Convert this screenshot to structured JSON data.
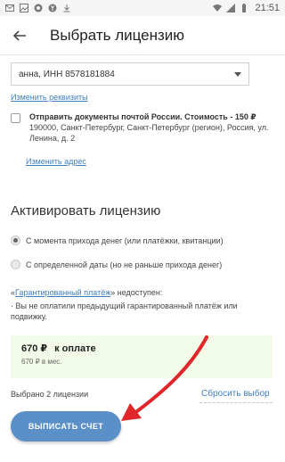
{
  "status_bar": {
    "time": "21:51"
  },
  "header": {
    "title": "Выбрать лицензию"
  },
  "requisites": {
    "selected": "анна, ИНН 8578181884",
    "edit_link": "Изменить реквизиты"
  },
  "post_delivery": {
    "label": "Отправить документы почтой России. Стоимость - 150 ₽",
    "address": "190000, Санкт-Петербург, Санкт-Петербург (регион), Россия, ул. Ленина, д. 2",
    "change_address_link": "Изменить адрес",
    "checked": false
  },
  "activation": {
    "title": "Активировать лицензию",
    "options": [
      {
        "label": "С момента прихода денег (или платёжки, квитанции)",
        "selected": true
      },
      {
        "label": "С определенной даты (но не раньше прихода денег)",
        "selected": false
      }
    ]
  },
  "guarantee": {
    "prefix": "«",
    "link": "Гарантированный платёж",
    "suffix": "» недоступен:",
    "reason": "· Вы не оплатили предыдущий гарантированный платёж или подвижку."
  },
  "payment": {
    "amount": "670 ₽",
    "label": "к оплате",
    "per_month": "670 ₽ в мес."
  },
  "selection": {
    "count_text": "Выбрано 2 лицензии",
    "reset_link": "Сбросить выбор"
  },
  "action": {
    "invoice_button": "ВЫПИСАТЬ СЧЕТ"
  },
  "colors": {
    "accent": "#5b8fc7",
    "link": "#3f7fbf",
    "pay_bg": "#f1fbe7",
    "arrow": "#e0262a"
  }
}
